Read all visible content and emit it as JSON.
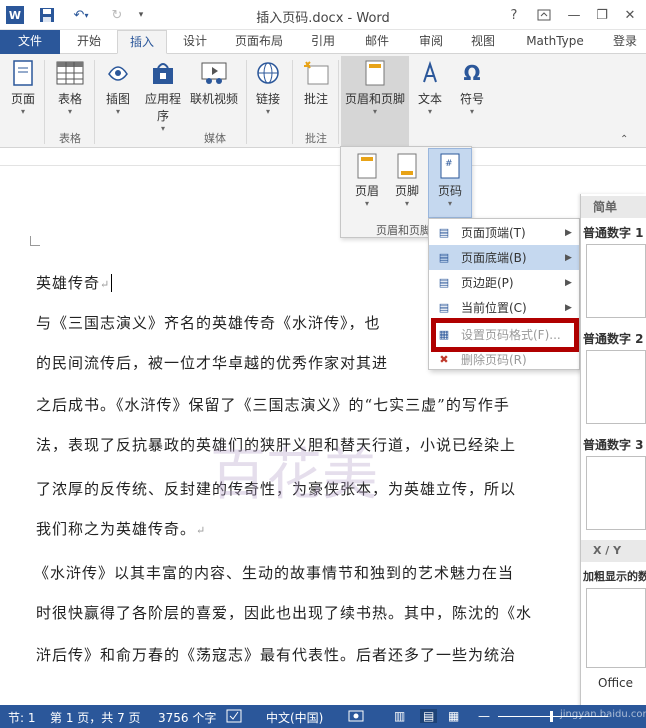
{
  "window": {
    "title": "插入页码.docx - Word",
    "help": "?",
    "word_badge": "W"
  },
  "tabs": [
    {
      "label": "文件"
    },
    {
      "label": "开始"
    },
    {
      "label": "插入"
    },
    {
      "label": "设计"
    },
    {
      "label": "页面布局"
    },
    {
      "label": "引用"
    },
    {
      "label": "邮件"
    },
    {
      "label": "审阅"
    },
    {
      "label": "视图"
    },
    {
      "label": "MathType"
    },
    {
      "label": "登录"
    }
  ],
  "ribbon": {
    "buttons": {
      "page": "页面",
      "table": "表格",
      "picture": "插图",
      "apps": "应用程",
      "apps2": "序",
      "online_video": "联机视频",
      "link": "链接",
      "comment": "批注",
      "header_footer": "页眉和页脚",
      "text": "文本",
      "symbol": "符号"
    },
    "groups": {
      "table": "表格",
      "media": "媒体",
      "comment": "批注"
    }
  },
  "hf_panel": {
    "header": "页眉",
    "footer": "页脚",
    "page_number": "页码",
    "group_label": "页眉和页脚"
  },
  "menu": [
    {
      "label": "页面顶端(T)"
    },
    {
      "label": "页面底端(B)"
    },
    {
      "label": "页边距(P)"
    },
    {
      "label": "当前位置(C)"
    },
    {
      "label": "设置页码格式(F)..."
    },
    {
      "label": "删除页码(R)"
    }
  ],
  "gallery": {
    "section_simple": "简单",
    "items": [
      "普通数字 1",
      "普通数字 2",
      "普通数字 3"
    ],
    "section_xy": "X / Y",
    "bold_item": "加粗显示的数",
    "office": "Office"
  },
  "document": {
    "lines": [
      "英雄传奇",
      "与《三国志演义》齐名的英雄传奇《水浒传》，也",
      "的民间流传后，被一位才华卓越的优秀作家对其进",
      "之后成书。《水浒传》保留了《三国志演义》的“七实三虚”的写作手",
      "法，表现了反抗暴政的英雄们的狭肝义胆和替天行道，小说已经染上",
      "了浓厚的反传统、反封建的传奇性，为豪侠张本，为英雄立传，所以",
      "我们称之为英雄传奇。",
      "《水浒传》以其丰富的内容、生动的故事情节和独到的艺术魅力在当",
      "时很快赢得了各阶层的喜爱，因此也出现了续书热。其中，陈沈的《水",
      "浒后传》和俞万春的《荡寇志》最有代表性。后者还多了一些为统治"
    ],
    "watermark": "百花美"
  },
  "status": {
    "section": "节: 1",
    "page": "第 1 页，共 7 页",
    "words": "3756 个字",
    "lang": "中文(中国)",
    "watermark": "jingyan.baidu.com"
  },
  "colors": {
    "accent": "#2b579a",
    "highlight": "#c5d8ef",
    "callout": "#b00000"
  }
}
